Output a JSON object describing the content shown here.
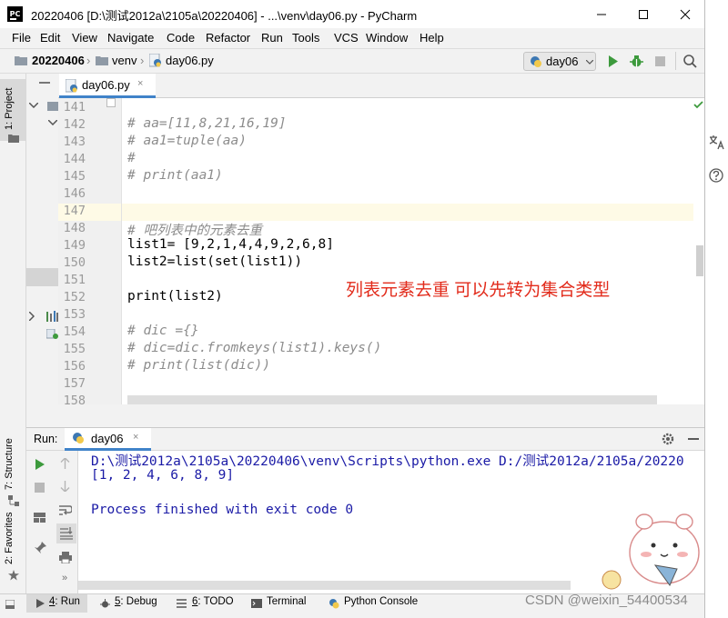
{
  "window": {
    "title": "20220406 [D:\\测试2012a\\2105a\\20220406] - ...\\venv\\day06.py - PyCharm",
    "app_icon_text": "PC"
  },
  "menu": [
    "File",
    "Edit",
    "View",
    "Navigate",
    "Code",
    "Refactor",
    "Run",
    "Tools",
    "VCS",
    "Window",
    "Help"
  ],
  "breadcrumb": {
    "project": "20220406",
    "folder": "venv",
    "file": "day06.py"
  },
  "run_config": {
    "selected": "day06"
  },
  "left_strip": {
    "project_tab": "1: Project",
    "structure_tab": "7: Structure",
    "favorites_tab": "2: Favorites"
  },
  "editor": {
    "tab_label": "day06.py",
    "lines": [
      {
        "n": "141",
        "text": ""
      },
      {
        "n": "142",
        "text": "# aa=[11,8,21,16,19]",
        "kind": "comment"
      },
      {
        "n": "143",
        "text": "# aa1=tuple(aa)",
        "kind": "comment"
      },
      {
        "n": "144",
        "text": "#",
        "kind": "comment"
      },
      {
        "n": "145",
        "text": "# print(aa1)",
        "kind": "comment"
      },
      {
        "n": "146",
        "text": ""
      },
      {
        "n": "147",
        "text": ""
      },
      {
        "n": "148",
        "text": "# 吧列表中的元素去重",
        "kind": "comment"
      },
      {
        "n": "149",
        "text": "list1= [9,2,1,4,4,9,2,6,8]",
        "kind": "plain"
      },
      {
        "n": "150",
        "text": "list2=list(set(list1))",
        "kind": "plain"
      },
      {
        "n": "151",
        "text": ""
      },
      {
        "n": "152",
        "text": "print(list2)",
        "kind": "plain"
      },
      {
        "n": "153",
        "text": ""
      },
      {
        "n": "154",
        "text": "# dic ={}",
        "kind": "comment"
      },
      {
        "n": "155",
        "text": "# dic=dic.fromkeys(list1).keys()",
        "kind": "comment"
      },
      {
        "n": "156",
        "text": "# print(list(dic))",
        "kind": "comment"
      },
      {
        "n": "157",
        "text": ""
      },
      {
        "n": "158",
        "text": ""
      }
    ],
    "annotation": "列表元素去重     可以先转为集合类型"
  },
  "run_panel": {
    "label": "Run:",
    "tab_label": "day06",
    "output": [
      "D:\\测试2012a\\2105a\\20220406\\venv\\Scripts\\python.exe D:/测试2012a/2105a/20220",
      "[1, 2, 4, 6, 8, 9]",
      "",
      "Process finished with exit code 0"
    ]
  },
  "bottom_tabs": [
    {
      "key": "4",
      "rest": ": Run"
    },
    {
      "key": "5",
      "rest": ": Debug"
    },
    {
      "key": "6",
      "rest": ": TODO"
    },
    {
      "key": "",
      "rest": "Terminal"
    },
    {
      "key": "",
      "rest": "Python Console"
    }
  ],
  "watermark": "CSDN @weixin_54400534",
  "colors": {
    "comment": "#8c8c8c",
    "annotation": "#e22b1b",
    "console_blue": "#1a1aa6",
    "caret_line": "#fefae6",
    "tab_underline": "#4083c9",
    "run_green": "#3d9a3d"
  }
}
